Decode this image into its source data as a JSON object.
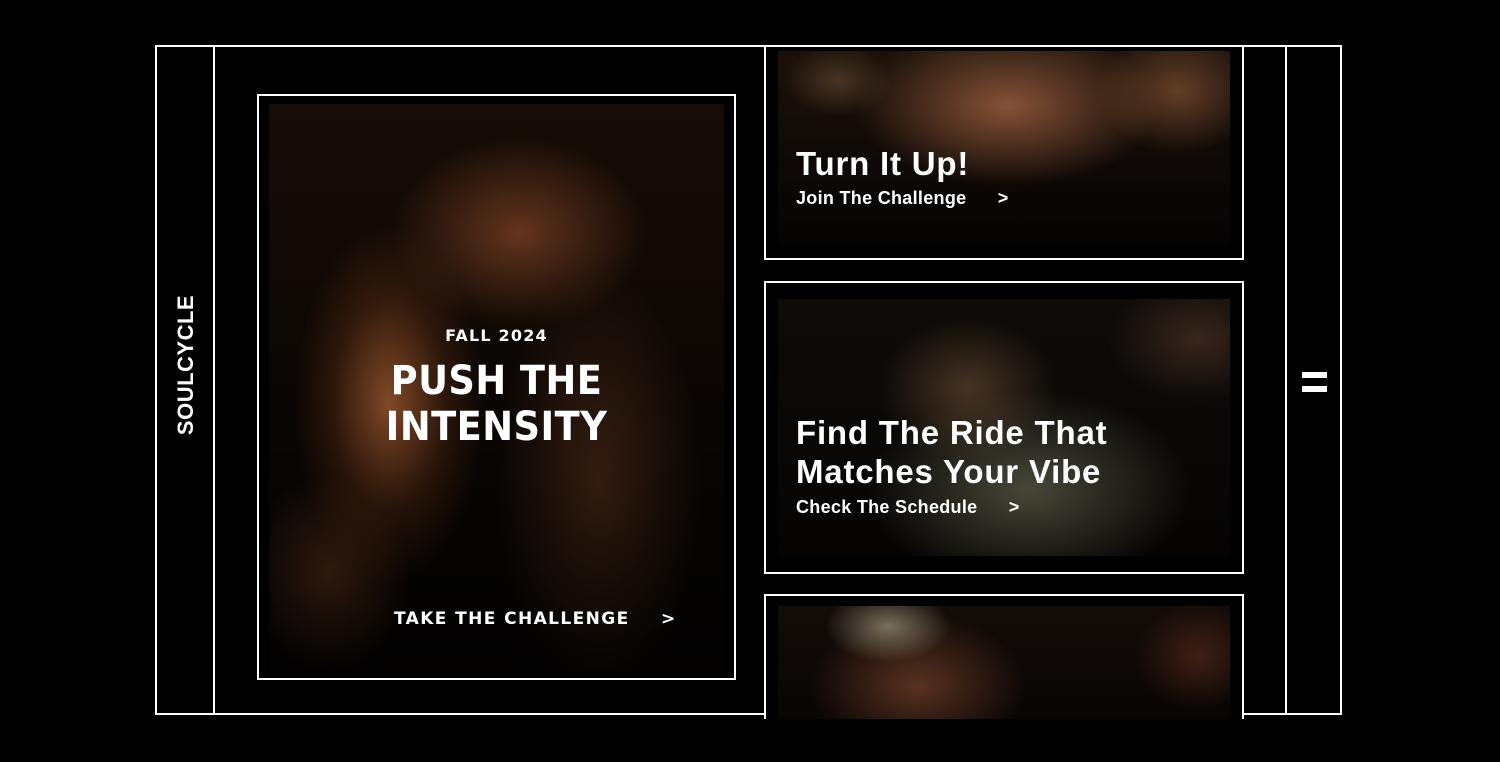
{
  "brand": "SOULCYCLE",
  "menu": {
    "icon": "hamburger-menu-icon"
  },
  "hero": {
    "eyebrow": "FALL 2024",
    "title": "PUSH THE INTENSITY",
    "cta_label": "TAKE THE CHALLENGE",
    "cta_arrow": ">"
  },
  "cards": [
    {
      "title": "Turn It Up!",
      "link_label": "Join The Challenge",
      "link_arrow": ">"
    },
    {
      "title": "Find The Ride That Matches Your Vibe",
      "link_label": "Check The Schedule",
      "link_arrow": ">"
    }
  ],
  "colors": {
    "background": "#000000",
    "foreground": "#ffffff"
  }
}
